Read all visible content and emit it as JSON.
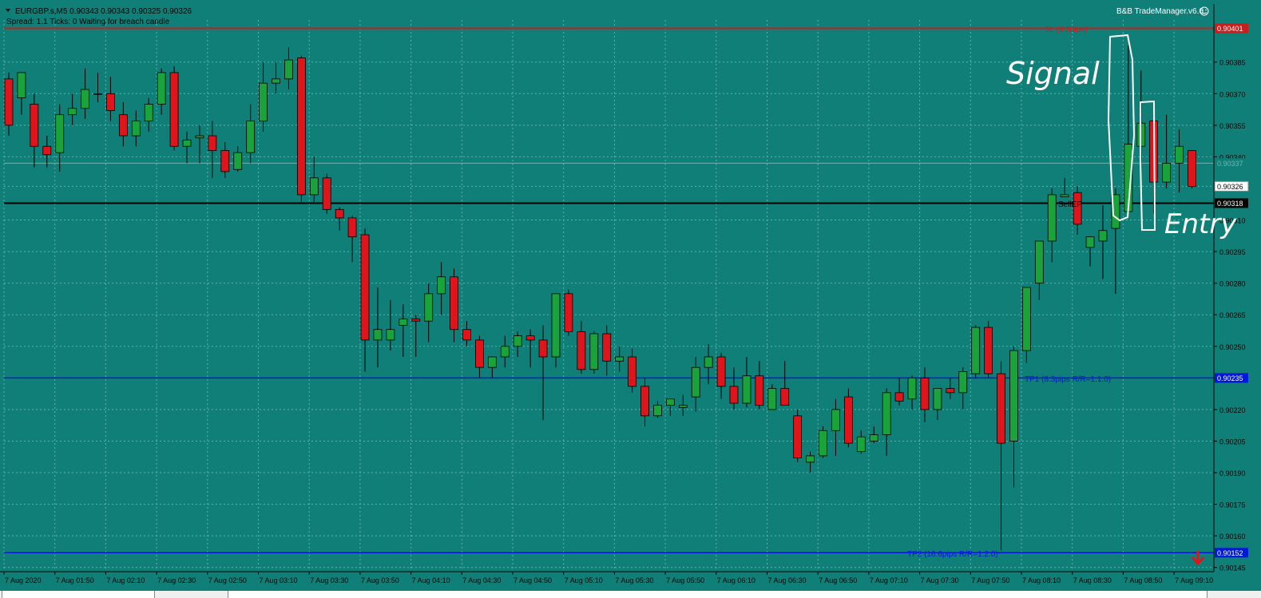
{
  "header": {
    "symbol_line": "EURGBP.s,M5  0.90343 0.90343 0.90325 0.90326",
    "status_line": "Spread: 1.1   Ticks: 0   Waiting for breach candle",
    "plugin": "B&B TradeManager.v6.6"
  },
  "colors": {
    "background": "#0f7f78",
    "grid": "#5fb3ad",
    "bull": "#1aa33a",
    "bear": "#e0151c",
    "wick": "#000000",
    "sl": "#c81e1e",
    "tp": "#0018d8",
    "entry": "#000000",
    "axis_text": "#000000",
    "annotation": "#ffffff"
  },
  "annotations": {
    "sl": "SL (8.3pips)",
    "tp1": "TP1 (8.3pips R/R=1:1.0)",
    "tp2": "TP2 (16.6pips R/R=1:2.0)",
    "sell_ep": "SellEP",
    "signal": "Signal",
    "entry": "Entry"
  },
  "icons": {
    "sell_arrow": "red-down-arrow-icon",
    "smiley": "smiley-icon"
  },
  "chart_data": {
    "type": "candlestick",
    "ylim": [
      0.90143,
      0.90405
    ],
    "yticks": [
      0.90385,
      0.9037,
      0.90355,
      0.9034,
      0.90326,
      0.9031,
      0.90295,
      0.9028,
      0.90265,
      0.9025,
      0.90235,
      0.9022,
      0.90205,
      0.9019,
      0.90175,
      0.9016,
      0.90145
    ],
    "ytick_labels": [
      "0.90385",
      "0.90370",
      "0.90355",
      "0.90340",
      "0.90326",
      "0.90310",
      "0.90295",
      "0.90280",
      "0.90265",
      "0.90250",
      "0.90235",
      "0.90220",
      "0.90205",
      "0.90190",
      "0.90175",
      "0.90160",
      "0.90145"
    ],
    "price_tags": [
      {
        "label": "0.90401",
        "value": 0.90401,
        "kind": "sl"
      },
      {
        "label": "0.90337",
        "value": 0.90337,
        "kind": "faint"
      },
      {
        "label": "0.90326",
        "value": 0.90326,
        "kind": "current"
      },
      {
        "label": "0.90318",
        "value": 0.90318,
        "kind": "entry"
      },
      {
        "label": "0.90235",
        "value": 0.90235,
        "kind": "tp"
      },
      {
        "label": "0.90152",
        "value": 0.90152,
        "kind": "tp"
      }
    ],
    "levels": {
      "sl": 0.90401,
      "entry": 0.90318,
      "tp1": 0.90235,
      "tp2": 0.90152
    },
    "xtick_labels": [
      "7 Aug 2020",
      "7 Aug 01:50",
      "7 Aug 02:10",
      "7 Aug 02:30",
      "7 Aug 02:50",
      "7 Aug 03:10",
      "7 Aug 03:30",
      "7 Aug 03:50",
      "7 Aug 04:10",
      "7 Aug 04:30",
      "7 Aug 04:50",
      "7 Aug 05:10",
      "7 Aug 05:30",
      "7 Aug 05:50",
      "7 Aug 06:10",
      "7 Aug 06:30",
      "7 Aug 06:50",
      "7 Aug 07:10",
      "7 Aug 07:30",
      "7 Aug 07:50",
      "7 Aug 08:10",
      "7 Aug 08:30",
      "7 Aug 08:50",
      "7 Aug 09:10"
    ],
    "candles": [
      [
        0.90377,
        0.9038,
        0.9035,
        0.90355
      ],
      [
        0.90368,
        0.9038,
        0.9036,
        0.9038
      ],
      [
        0.90365,
        0.9037,
        0.90335,
        0.90345
      ],
      [
        0.90345,
        0.9035,
        0.90335,
        0.90341
      ],
      [
        0.90342,
        0.90365,
        0.90333,
        0.9036
      ],
      [
        0.9036,
        0.9037,
        0.90355,
        0.90363
      ],
      [
        0.90363,
        0.90382,
        0.90358,
        0.90372
      ],
      [
        0.9037,
        0.9038,
        0.90366,
        0.9037
      ],
      [
        0.9037,
        0.90378,
        0.90357,
        0.90362
      ],
      [
        0.9036,
        0.90366,
        0.90345,
        0.9035
      ],
      [
        0.9035,
        0.90362,
        0.90345,
        0.90357
      ],
      [
        0.90357,
        0.90368,
        0.90352,
        0.90365
      ],
      [
        0.90365,
        0.90382,
        0.9036,
        0.9038
      ],
      [
        0.9038,
        0.90383,
        0.90343,
        0.90345
      ],
      [
        0.90345,
        0.90352,
        0.90337,
        0.90348
      ],
      [
        0.90349,
        0.90355,
        0.90337,
        0.9035
      ],
      [
        0.9035,
        0.90357,
        0.9033,
        0.90343
      ],
      [
        0.90343,
        0.90347,
        0.9033,
        0.90333
      ],
      [
        0.90334,
        0.90345,
        0.90333,
        0.90342
      ],
      [
        0.90342,
        0.90365,
        0.90337,
        0.90357
      ],
      [
        0.90357,
        0.90385,
        0.90352,
        0.90375
      ],
      [
        0.90375,
        0.90385,
        0.9037,
        0.90377
      ],
      [
        0.90377,
        0.90392,
        0.90372,
        0.90386
      ],
      [
        0.90387,
        0.90388,
        0.90318,
        0.90322
      ],
      [
        0.90322,
        0.9034,
        0.90318,
        0.9033
      ],
      [
        0.9033,
        0.90332,
        0.90313,
        0.90315
      ],
      [
        0.90315,
        0.90316,
        0.90305,
        0.90311
      ],
      [
        0.90311,
        0.90312,
        0.9029,
        0.90302
      ],
      [
        0.90303,
        0.90306,
        0.90238,
        0.90253
      ],
      [
        0.90253,
        0.90278,
        0.9024,
        0.90258
      ],
      [
        0.90253,
        0.90272,
        0.90248,
        0.90258
      ],
      [
        0.9026,
        0.9027,
        0.90245,
        0.90263
      ],
      [
        0.90263,
        0.90265,
        0.90245,
        0.90262
      ],
      [
        0.90262,
        0.9028,
        0.90252,
        0.90275
      ],
      [
        0.90275,
        0.9029,
        0.90265,
        0.90283
      ],
      [
        0.90283,
        0.90287,
        0.90252,
        0.90258
      ],
      [
        0.90258,
        0.90262,
        0.9025,
        0.90253
      ],
      [
        0.90253,
        0.90255,
        0.90235,
        0.9024
      ],
      [
        0.9024,
        0.90245,
        0.90235,
        0.90245
      ],
      [
        0.90245,
        0.90255,
        0.9024,
        0.9025
      ],
      [
        0.9025,
        0.90257,
        0.90245,
        0.90255
      ],
      [
        0.90255,
        0.90258,
        0.9024,
        0.90253
      ],
      [
        0.90253,
        0.9026,
        0.90215,
        0.90245
      ],
      [
        0.90245,
        0.90275,
        0.9024,
        0.90275
      ],
      [
        0.90275,
        0.90277,
        0.90255,
        0.90257
      ],
      [
        0.90257,
        0.90262,
        0.90237,
        0.90239
      ],
      [
        0.90239,
        0.90257,
        0.90237,
        0.90256
      ],
      [
        0.90256,
        0.9026,
        0.90236,
        0.90243
      ],
      [
        0.90243,
        0.9025,
        0.90238,
        0.90245
      ],
      [
        0.90245,
        0.90249,
        0.90228,
        0.90231
      ],
      [
        0.90231,
        0.90235,
        0.90212,
        0.90217
      ],
      [
        0.90217,
        0.90224,
        0.90216,
        0.90222
      ],
      [
        0.90222,
        0.90225,
        0.90217,
        0.90225
      ],
      [
        0.90221,
        0.90227,
        0.90217,
        0.90222
      ],
      [
        0.90226,
        0.90245,
        0.90219,
        0.9024
      ],
      [
        0.9024,
        0.90251,
        0.90232,
        0.90245
      ],
      [
        0.90245,
        0.90247,
        0.90225,
        0.90231
      ],
      [
        0.90231,
        0.9024,
        0.9022,
        0.90223
      ],
      [
        0.90223,
        0.90245,
        0.90221,
        0.90236
      ],
      [
        0.90236,
        0.90243,
        0.9022,
        0.90222
      ],
      [
        0.9022,
        0.90232,
        0.9022,
        0.9023
      ],
      [
        0.9023,
        0.90243,
        0.90222,
        0.90222
      ],
      [
        0.90217,
        0.9022,
        0.90195,
        0.90197
      ],
      [
        0.90195,
        0.902,
        0.9019,
        0.90198
      ],
      [
        0.90198,
        0.90212,
        0.90197,
        0.9021
      ],
      [
        0.9021,
        0.90225,
        0.90198,
        0.9022
      ],
      [
        0.90226,
        0.9023,
        0.90202,
        0.90204
      ],
      [
        0.902,
        0.9021,
        0.90199,
        0.90207
      ],
      [
        0.90205,
        0.90212,
        0.90204,
        0.90208
      ],
      [
        0.90208,
        0.9023,
        0.90198,
        0.90228
      ],
      [
        0.90228,
        0.90235,
        0.90222,
        0.90224
      ],
      [
        0.90225,
        0.90236,
        0.9022,
        0.90235
      ],
      [
        0.90235,
        0.9024,
        0.90214,
        0.9022
      ],
      [
        0.9022,
        0.9023,
        0.90215,
        0.9023
      ],
      [
        0.9023,
        0.90235,
        0.90225,
        0.90228
      ],
      [
        0.90228,
        0.9024,
        0.9022,
        0.90238
      ],
      [
        0.90237,
        0.9026,
        0.90235,
        0.90259
      ],
      [
        0.90259,
        0.90262,
        0.90235,
        0.90237
      ],
      [
        0.90237,
        0.90243,
        0.90153,
        0.90204
      ],
      [
        0.90205,
        0.9025,
        0.90183,
        0.90248
      ],
      [
        0.90248,
        0.90278,
        0.90242,
        0.90278
      ],
      [
        0.9028,
        0.903,
        0.90272,
        0.903
      ],
      [
        0.903,
        0.90325,
        0.9029,
        0.90322
      ],
      [
        0.90321,
        0.9033,
        0.90322,
        0.90322
      ],
      [
        0.90323,
        0.90326,
        0.90303,
        0.90308
      ],
      [
        0.90297,
        0.90301,
        0.90288,
        0.90302
      ],
      [
        0.903,
        0.90317,
        0.90282,
        0.90305
      ],
      [
        0.90306,
        0.90325,
        0.90275,
        0.90322
      ],
      [
        0.90314,
        0.90393,
        0.90315,
        0.90346
      ],
      [
        0.90345,
        0.90381,
        0.9032,
        0.90356
      ],
      [
        0.90357,
        0.90362,
        0.90313,
        0.90328
      ],
      [
        0.90328,
        0.9036,
        0.90325,
        0.90337
      ],
      [
        0.90337,
        0.90353,
        0.90323,
        0.90345
      ],
      [
        0.90343,
        0.90343,
        0.90325,
        0.90326
      ]
    ]
  }
}
